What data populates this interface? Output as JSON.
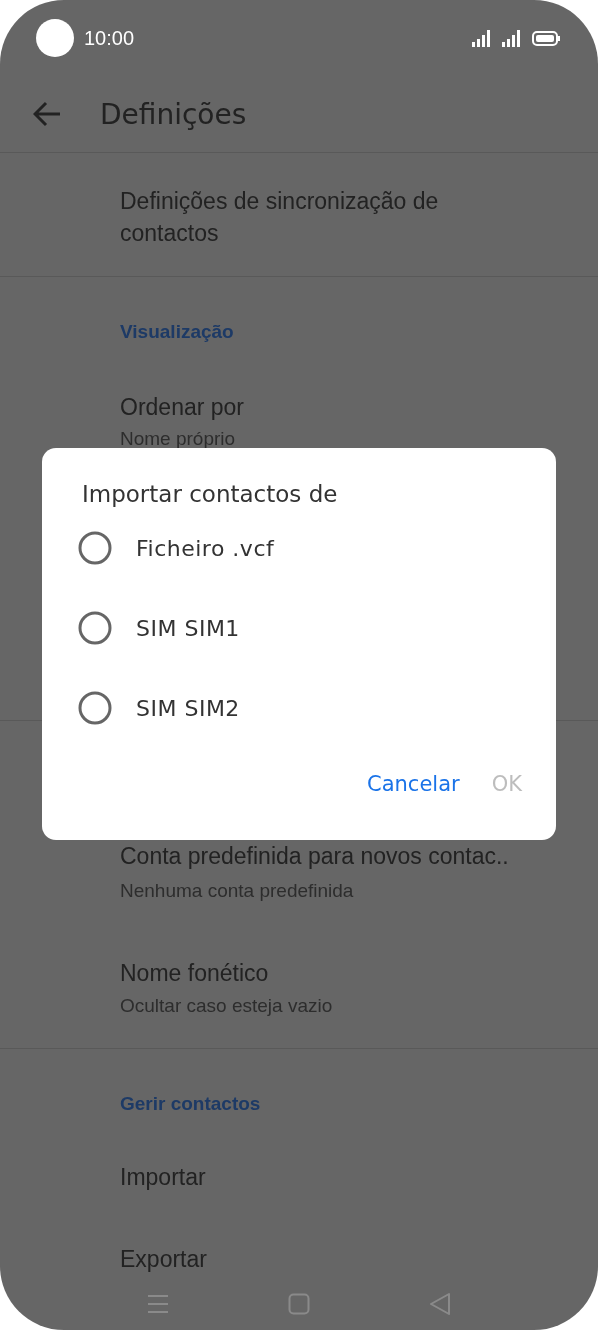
{
  "status_bar": {
    "time": "10:00"
  },
  "toolbar": {
    "title": "Definições"
  },
  "settings": [
    {
      "kind": "item",
      "title": "Definições de sincronização de contactos"
    },
    {
      "kind": "header",
      "title": "Visualização"
    },
    {
      "kind": "item",
      "title": "Ordenar por",
      "subtitle": "Nome próprio"
    },
    {
      "kind": "item",
      "title": "Conta predefinida para novos contac..",
      "subtitle": "Nenhuma conta predefinida"
    },
    {
      "kind": "item",
      "title": "Nome fonético",
      "subtitle": "Ocultar caso esteja vazio"
    },
    {
      "kind": "header",
      "title": "Gerir contactos"
    },
    {
      "kind": "item",
      "title": "Importar"
    },
    {
      "kind": "item",
      "title": "Exportar"
    }
  ],
  "dialog": {
    "title": "Importar contactos de",
    "options": [
      {
        "label": "Ficheiro .vcf",
        "selected": false
      },
      {
        "label": "SIM SIM1",
        "selected": false
      },
      {
        "label": "SIM SIM2",
        "selected": false
      }
    ],
    "buttons": [
      {
        "label": "Cancelar",
        "disabled": false
      },
      {
        "label": "OK",
        "disabled": true
      }
    ]
  }
}
